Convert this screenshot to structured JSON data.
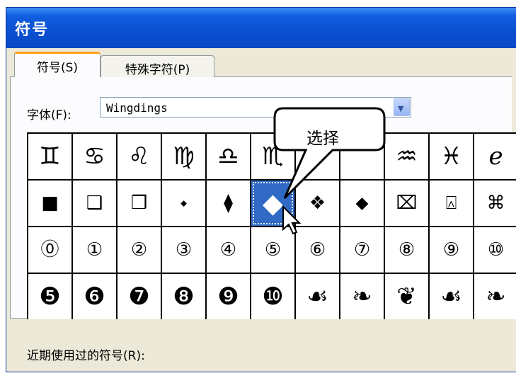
{
  "dialog": {
    "title": "符号",
    "tabs": [
      {
        "label": "符号(S)",
        "active": true
      },
      {
        "label": "特殊字符(P)",
        "active": false
      }
    ],
    "font_label": "字体(F):",
    "font_value": "Wingdings",
    "recent_label": "近期使用过的符号(R):"
  },
  "grid": {
    "rows": [
      [
        "♊",
        "♋",
        "♌",
        "♍",
        "♎",
        "♏",
        "",
        "",
        "♒",
        "♓",
        "ℯ"
      ],
      [
        "■",
        "❑",
        "❒",
        "⬩",
        "⧫",
        "◆",
        "❖",
        "⬥",
        "⌧",
        "⍓",
        "⌘"
      ],
      [
        "⓪",
        "①",
        "②",
        "③",
        "④",
        "⑤",
        "⑥",
        "⑦",
        "⑧",
        "⑨",
        "⑩"
      ],
      [
        "❺",
        "❻",
        "❼",
        "❽",
        "❾",
        "❿",
        "☙",
        "❧",
        "❦",
        "☙",
        "❧"
      ]
    ],
    "selected_row": 1,
    "selected_col": 5
  },
  "callout": {
    "text": "选择"
  },
  "colors": {
    "titlebar": "#0a4fd0",
    "selected": "#316ac5",
    "tab_highlight": "#ff9f1a"
  }
}
